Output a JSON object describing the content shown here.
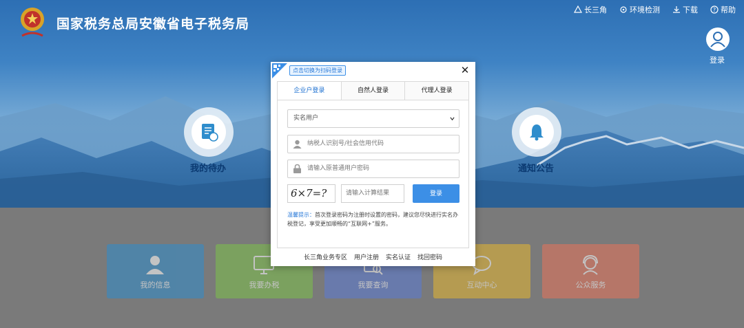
{
  "header": {
    "site_title": "国家税务总局安徽省电子税务局",
    "top_links": [
      "长三角",
      "环境检测",
      "下载",
      "帮助"
    ],
    "login_label": "登录"
  },
  "hero": {
    "left_circle_label": "我的待办",
    "right_circle_label": "通知公告"
  },
  "tiles": [
    {
      "label": "我的信息",
      "color": "#2f8dcc"
    },
    {
      "label": "我要办税",
      "color": "#7cc24a"
    },
    {
      "label": "我要查询",
      "color": "#5b7ad6"
    },
    {
      "label": "互动中心",
      "color": "#e6b630"
    },
    {
      "label": "公众服务",
      "color": "#e8735a"
    }
  ],
  "modal": {
    "qr_tip": "点击切换为扫码登录",
    "tabs": [
      "企业户登录",
      "自然人登录",
      "代理人登录"
    ],
    "active_tab": 0,
    "user_type_selected": "实名用户",
    "taxpayer_id_placeholder": "纳税人识别号/社会信用代码",
    "password_placeholder": "请输入原普通用户密码",
    "captcha_text": "6×7=?",
    "calc_placeholder": "请输入计算结果",
    "login_button": "登录",
    "tip_key": "温馨提示：",
    "tip_text": "首次登录密码为注册时设置的密码，建议您尽快进行实名办税登记，享受更加顺畅的“互联网+”服务。",
    "footer_links": [
      "长三角业务专区",
      "用户注册",
      "实名认证",
      "找回密码"
    ]
  },
  "colors": {
    "accent": "#3c8fe6",
    "tab_active": "#1b6fd0"
  }
}
